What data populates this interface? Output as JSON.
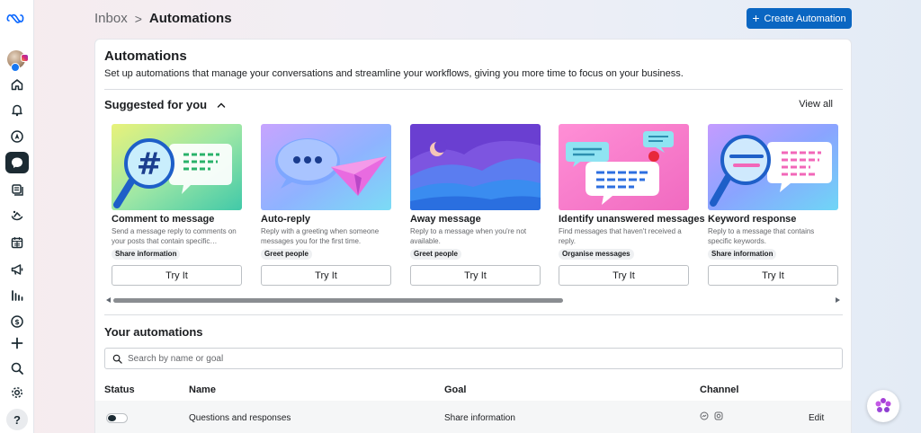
{
  "breadcrumb": {
    "parent": "Inbox",
    "separator": ">",
    "current": "Automations"
  },
  "header": {
    "create_button": "Create Automation",
    "create_icon": "+"
  },
  "main": {
    "title": "Automations",
    "subtitle": "Set up automations that manage your conversations and streamline your workflows, giving you more time to focus on your business.",
    "suggested": {
      "title": "Suggested for you",
      "view_all": "View all",
      "cards": [
        {
          "name": "Comment to message",
          "description": "Send a message reply to comments on your posts that contain specific…",
          "tag": "Share information",
          "action": "Try It"
        },
        {
          "name": "Auto-reply",
          "description": "Reply with a greeting when someone messages you for the first time.",
          "tag": "Greet people",
          "action": "Try It"
        },
        {
          "name": "Away message",
          "description": "Reply to a message when you're not available.",
          "tag": "Greet people",
          "action": "Try It"
        },
        {
          "name": "Identify unanswered messages",
          "description": "Find messages that haven't received a reply.",
          "tag": "Organise messages",
          "action": "Try It"
        },
        {
          "name": "Keyword response",
          "description": "Reply to a message that contains specific keywords.",
          "tag": "Share information",
          "action": "Try It"
        }
      ]
    },
    "your_automations": {
      "title": "Your automations",
      "search_placeholder": "Search by name or goal",
      "columns": {
        "status": "Status",
        "name": "Name",
        "goal": "Goal",
        "channel": "Channel"
      },
      "rows": [
        {
          "status": "off",
          "name": "Questions and responses",
          "goal": "Share information",
          "channels": [
            "messenger-icon",
            "instagram-icon"
          ],
          "action": "Edit"
        }
      ]
    }
  },
  "sidebar": {
    "items": [
      "meta-logo",
      "account-avatar",
      "home-icon",
      "notifications-icon",
      "compass-icon",
      "inbox-icon",
      "content-icon",
      "engagement-icon",
      "calendar-icon",
      "ads-icon",
      "insights-icon",
      "monetization-icon",
      "add-icon",
      "search-icon",
      "settings-icon",
      "help-icon"
    ],
    "help": "?"
  },
  "colors": {
    "primary": "#0a66c2",
    "sidebar_active": "#1c2b33",
    "text": "#1c1e21",
    "muted": "#65676b"
  }
}
